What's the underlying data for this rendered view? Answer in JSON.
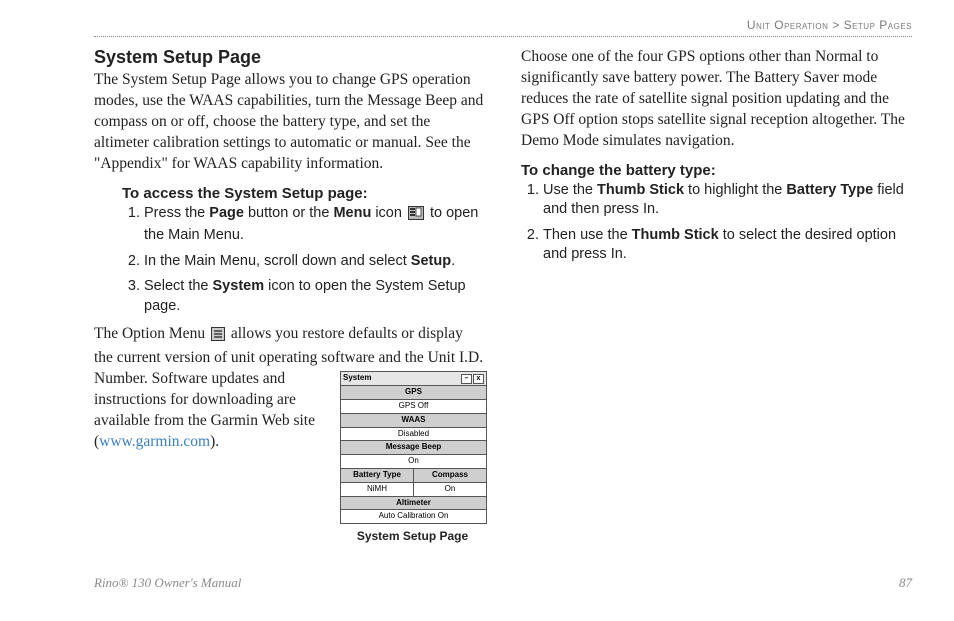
{
  "breadcrumb": {
    "left": "Unit Operation",
    "sep": ">",
    "right": "Setup Pages"
  },
  "footer": {
    "product": "Rino® 130 Owner's Manual",
    "page": "87"
  },
  "left": {
    "title": "System Setup Page",
    "intro": "The System Setup Page allows you to change GPS operation modes, use the WAAS capabilities, turn the Message Beep and compass on or off, choose the battery type, and set the altimeter calibration settings to automatic or manual. See the \"Appendix\" for WAAS capability information.",
    "sub1": "To access the System Setup page:",
    "steps1": {
      "s1a": "Press the ",
      "s1b": "Page",
      "s1c": " button or the ",
      "s1d": "Menu",
      "s1e": " icon ",
      "s1f": " to open the Main Menu.",
      "s2a": "In the Main Menu, scroll down and select ",
      "s2b": "Setup",
      "s2c": ".",
      "s3a": "Select the ",
      "s3b": "System",
      "s3c": " icon to open the System Setup page."
    },
    "flow": {
      "a": "The Option Menu ",
      "b": " allows you restore defaults or display the current version of unit operating software and the Unit I.D. Number. Software updates and instructions for downloading are available from the Garmin Web site (",
      "link": "www.garmin.com",
      "c": ")."
    },
    "caption": "System Setup Page",
    "device": {
      "title": "System",
      "rows": [
        {
          "label": "GPS",
          "value": ""
        },
        {
          "single": "GPS Off"
        },
        {
          "label": "WAAS",
          "value": ""
        },
        {
          "single": "Disabled"
        },
        {
          "label": "Message Beep",
          "value": ""
        },
        {
          "single": "On"
        },
        {
          "label": "Battery Type",
          "label2": "Compass"
        },
        {
          "single": "NiMH",
          "single2": "On"
        },
        {
          "label": "Altimeter",
          "value": ""
        },
        {
          "single": "Auto Calibration On"
        }
      ]
    }
  },
  "right": {
    "intro": "Choose one of the four GPS options other than Normal to significantly save battery power. The Battery Saver mode reduces the rate of satellite signal position updating and the GPS Off option stops satellite signal reception altogether. The Demo Mode simulates navigation.",
    "sub1": "To change the battery type:",
    "steps1": {
      "s1a": "Use the ",
      "s1b": "Thumb Stick",
      "s1c": " to highlight the ",
      "s1d": "Battery Type",
      "s1e": " field and then press In.",
      "s2a": "Then use the ",
      "s2b": "Thumb Stick",
      "s2c": " to select the desired option and press In."
    }
  }
}
